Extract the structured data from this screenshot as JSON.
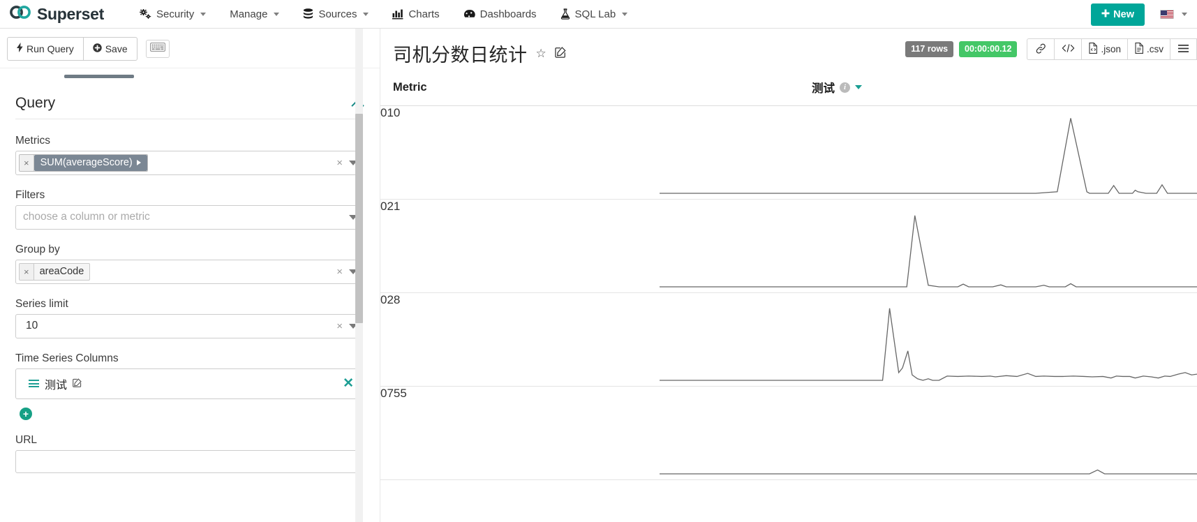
{
  "navbar": {
    "brand": "Superset",
    "brand_logo_icon": "superset-infinity-logo",
    "items": [
      {
        "label": "Security",
        "icon": "gears-icon",
        "caret": true,
        "name": "security"
      },
      {
        "label": "Manage",
        "icon": null,
        "caret": true,
        "name": "manage"
      },
      {
        "label": "Sources",
        "icon": "database-icon",
        "caret": true,
        "name": "sources"
      },
      {
        "label": "Charts",
        "icon": "bar-chart-icon",
        "caret": false,
        "name": "charts"
      },
      {
        "label": "Dashboards",
        "icon": "dashboard-icon",
        "caret": false,
        "name": "dashboards"
      },
      {
        "label": "SQL Lab",
        "icon": "flask-icon",
        "caret": true,
        "name": "sql-lab"
      }
    ],
    "new_button": {
      "label": "New",
      "icon": "plus-icon",
      "color": "#00a699"
    },
    "language": {
      "flag": "us-flag-icon",
      "caret": true
    }
  },
  "query_toolbar": {
    "run_query": {
      "label": "Run Query",
      "icon": "bolt-icon"
    },
    "save": {
      "label": "Save",
      "icon": "plus-circle-icon"
    },
    "keyboard_shortcuts_icon": "keyboard-icon"
  },
  "query_panel": {
    "section_title": "Query",
    "collapse_icon": "chevron-up-icon",
    "metrics": {
      "label": "Metrics",
      "token": "SUM(averageScore)",
      "token_remove": "×",
      "clear": "×",
      "dropdown_icon": "caret-down-icon"
    },
    "filters": {
      "label": "Filters",
      "placeholder": "choose a column or metric",
      "value": "",
      "dropdown_icon": "caret-down-icon"
    },
    "group_by": {
      "label": "Group by",
      "token": "areaCode",
      "token_remove": "×",
      "clear": "×",
      "dropdown_icon": "caret-down-icon"
    },
    "series_limit": {
      "label": "Series limit",
      "value": "10",
      "clear": "×",
      "dropdown_icon": "caret-down-icon"
    },
    "time_series_columns": {
      "label": "Time Series Columns",
      "entry": "测试",
      "drag_icon": "drag-handle-icon",
      "edit_icon": "edit-square-icon",
      "delete_icon": "close-icon",
      "add_icon": "plus-circle-icon"
    },
    "url": {
      "label": "URL",
      "value": "",
      "placeholder": ""
    }
  },
  "chart_header": {
    "title": "司机分数日统计",
    "favorite_icon": "star-outline-icon",
    "edit_icon": "edit-square-icon",
    "rows_badge": "117 rows",
    "rows_badge_color": "#7a7a7a",
    "time_badge": "00:00:00.12",
    "time_badge_color": "#44c767",
    "actions": [
      {
        "label": "",
        "icon": "link-icon",
        "name": "share-link-button"
      },
      {
        "label": "",
        "icon": "code-icon",
        "name": "embed-code-button"
      },
      {
        "label": ".json",
        "icon": "json-file-icon",
        "name": "export-json-button"
      },
      {
        "label": ".csv",
        "icon": "csv-file-icon",
        "name": "export-csv-button"
      },
      {
        "label": "",
        "icon": "hamburger-icon",
        "name": "more-options-button"
      }
    ]
  },
  "chart_data": {
    "type": "line",
    "title": "司机分数日统计",
    "columns": [
      "Metric",
      "测试"
    ],
    "column_info_icon": "info-icon",
    "column_sort_icon": "caret-down-icon",
    "xlabel": "",
    "ylabel": "",
    "line_color": "#666666",
    "series": [
      {
        "name": "010",
        "points": [
          [
            0.0,
            0
          ],
          [
            0.55,
            0
          ],
          [
            0.66,
            0
          ],
          [
            0.7,
            0
          ],
          [
            0.74,
            0.02
          ],
          [
            0.765,
            0.97
          ],
          [
            0.795,
            0.02
          ],
          [
            0.8,
            0
          ],
          [
            0.835,
            0
          ],
          [
            0.845,
            0.1
          ],
          [
            0.855,
            0
          ],
          [
            0.88,
            0
          ],
          [
            0.885,
            0.04
          ],
          [
            0.89,
            0.02
          ],
          [
            0.905,
            0
          ],
          [
            0.925,
            0
          ],
          [
            0.935,
            0.11
          ],
          [
            0.945,
            0
          ],
          [
            1.0,
            0
          ]
        ]
      },
      {
        "name": "021",
        "points": [
          [
            0.0,
            0
          ],
          [
            0.46,
            0
          ],
          [
            0.475,
            0.92
          ],
          [
            0.5,
            0.02
          ],
          [
            0.52,
            0
          ],
          [
            0.555,
            0
          ],
          [
            0.565,
            0.035
          ],
          [
            0.575,
            0
          ],
          [
            0.62,
            0
          ],
          [
            0.635,
            0.025
          ],
          [
            0.645,
            0
          ],
          [
            0.7,
            0
          ],
          [
            0.715,
            0.02
          ],
          [
            0.725,
            0
          ],
          [
            0.755,
            0
          ],
          [
            0.765,
            0.04
          ],
          [
            0.775,
            0
          ],
          [
            1.0,
            0
          ]
        ]
      },
      {
        "name": "028",
        "points": [
          [
            0.0,
            0
          ],
          [
            0.415,
            0
          ],
          [
            0.428,
            0.93
          ],
          [
            0.445,
            0.1
          ],
          [
            0.452,
            0.16
          ],
          [
            0.462,
            0.38
          ],
          [
            0.47,
            0.07
          ],
          [
            0.48,
            0.02
          ],
          [
            0.49,
            0
          ],
          [
            0.5,
            0.02
          ],
          [
            0.508,
            0
          ],
          [
            0.52,
            0
          ],
          [
            0.535,
            0.055
          ],
          [
            0.555,
            0.05
          ],
          [
            0.575,
            0.055
          ],
          [
            0.6,
            0.05
          ],
          [
            0.615,
            0.055
          ],
          [
            0.625,
            0.045
          ],
          [
            0.645,
            0.06
          ],
          [
            0.665,
            0.05
          ],
          [
            0.685,
            0.09
          ],
          [
            0.7,
            0.05
          ],
          [
            0.715,
            0.055
          ],
          [
            0.735,
            0.05
          ],
          [
            0.75,
            0.05
          ],
          [
            0.77,
            0.055
          ],
          [
            0.79,
            0.05
          ],
          [
            0.805,
            0.045
          ],
          [
            0.825,
            0.05
          ],
          [
            0.84,
            0.03
          ],
          [
            0.85,
            0.055
          ],
          [
            0.862,
            0.05
          ],
          [
            0.875,
            0.05
          ],
          [
            0.885,
            0.03
          ],
          [
            0.9,
            0.055
          ],
          [
            0.915,
            0.045
          ],
          [
            0.928,
            0.03
          ],
          [
            0.94,
            0.055
          ],
          [
            0.95,
            0.05
          ],
          [
            0.965,
            0.08
          ],
          [
            0.978,
            0.1
          ],
          [
            0.99,
            0.07
          ],
          [
            1.0,
            0.08
          ]
        ]
      },
      {
        "name": "0755",
        "points": [
          [
            0.0,
            0
          ],
          [
            0.8,
            0
          ],
          [
            0.815,
            0.05
          ],
          [
            0.828,
            0
          ],
          [
            1.0,
            0
          ]
        ]
      }
    ]
  },
  "scrollbar": {
    "up_arrow_icon": "triangle-up-icon"
  }
}
